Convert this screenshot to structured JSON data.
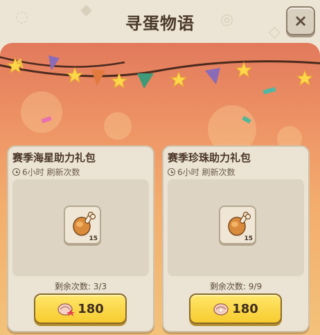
{
  "window": {
    "title": "寻蛋物语",
    "close_label": "×"
  },
  "cards": [
    {
      "title": "赛季海星助力礼包",
      "refresh_text": "6小时 刷新次数",
      "item_icon": "roasted-meat-icon",
      "item_count": "15",
      "remaining_text": "剩余次数: 3/3",
      "price": "180",
      "currency_icon": "shell-icon-with-star"
    },
    {
      "title": "赛季珍珠助力礼包",
      "refresh_text": "6小时 刷新次数",
      "item_icon": "roasted-meat-icon",
      "item_count": "15",
      "remaining_text": "剩余次数: 9/9",
      "price": "180",
      "currency_icon": "pearl-shell-icon"
    }
  ],
  "colors": {
    "accent_yellow": "#f7cc2f",
    "title_brown": "#4b3a2c",
    "panel_cream": "#ebe3d3"
  }
}
